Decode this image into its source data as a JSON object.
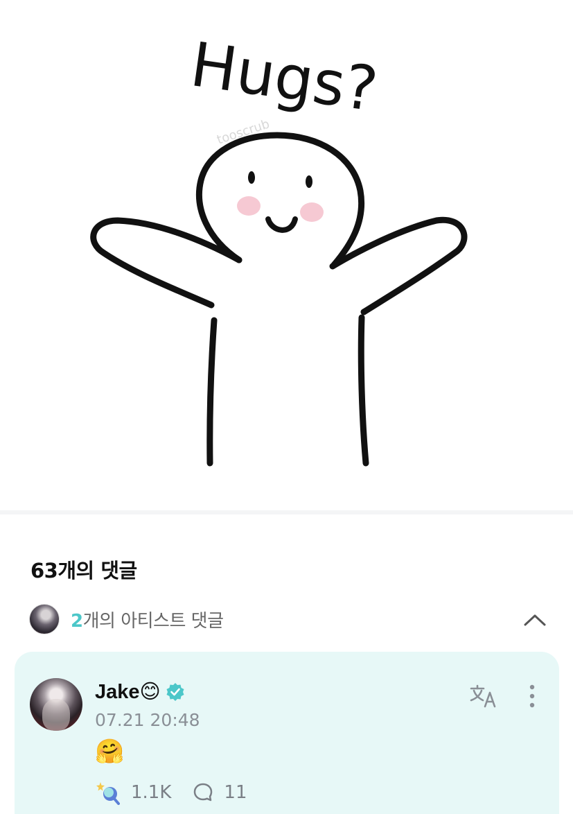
{
  "post": {
    "image_text": "Hugs?",
    "watermark": "tooscrub"
  },
  "comments": {
    "header": "63개의 댓글",
    "artist_comments": {
      "count": "2",
      "label": "개의 아티스트 댓글"
    }
  },
  "comment": {
    "author": "Jake😊",
    "time": "07.21 20:48",
    "body": "🤗",
    "likes": "1.1K",
    "replies": "11"
  },
  "colors": {
    "accent": "#4cc7c9",
    "card_bg": "#e7f8f7"
  },
  "icons": {
    "verified": "verified-badge-icon",
    "translate": "translate-icon",
    "more": "more-vertical-icon",
    "collapse": "chevron-up-icon",
    "like": "lightstick-like-icon",
    "reply": "reply-bubble-icon"
  }
}
